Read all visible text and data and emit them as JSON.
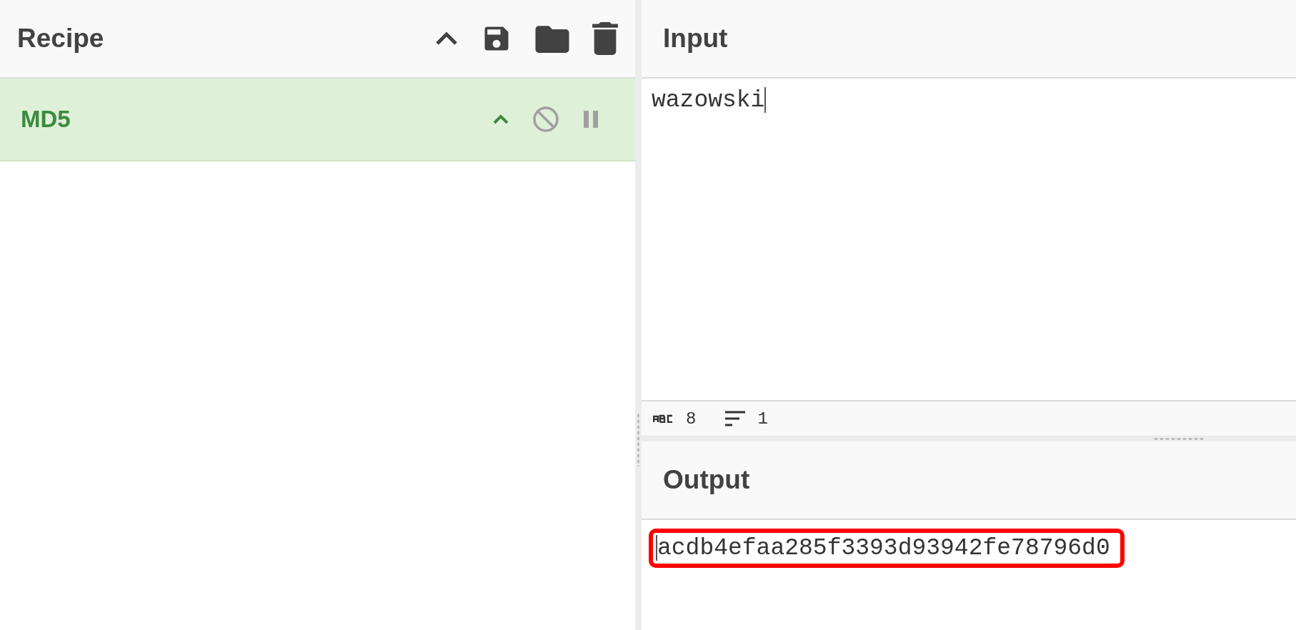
{
  "recipe": {
    "title": "Recipe"
  },
  "operations": [
    {
      "name": "MD5",
      "disabled": false,
      "breakpoint": false
    }
  ],
  "input": {
    "title": "Input",
    "value": "wazowski",
    "length": "8",
    "lines": "1"
  },
  "output": {
    "title": "Output",
    "value": "acdb4efaa285f3393d93942fe78796d0",
    "highlighted": true
  }
}
